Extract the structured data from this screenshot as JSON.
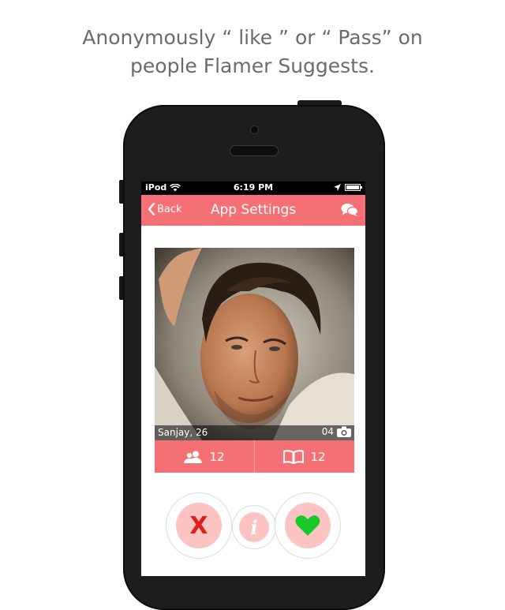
{
  "headline": {
    "line1": "Anonymously “ like ”  or  “ Pass” on",
    "line2": "people Flamer Suggests."
  },
  "status_bar": {
    "carrier": "iPod",
    "time": "6:19 PM"
  },
  "nav": {
    "back_label": "Back",
    "title": "App Settings",
    "chat_icon": "chat-bubbles-icon"
  },
  "profile": {
    "name_age": "Sanjay, 26",
    "photo_count": "04",
    "friends_count": "12",
    "likes_count": "12"
  },
  "actions": {
    "pass_label": "X",
    "info_label": "i",
    "like_icon": "heart-icon"
  },
  "colors": {
    "accent": "#f47074",
    "action_bg": "#fbc3c2",
    "pass": "#e01e1e",
    "like": "#19c92c"
  }
}
